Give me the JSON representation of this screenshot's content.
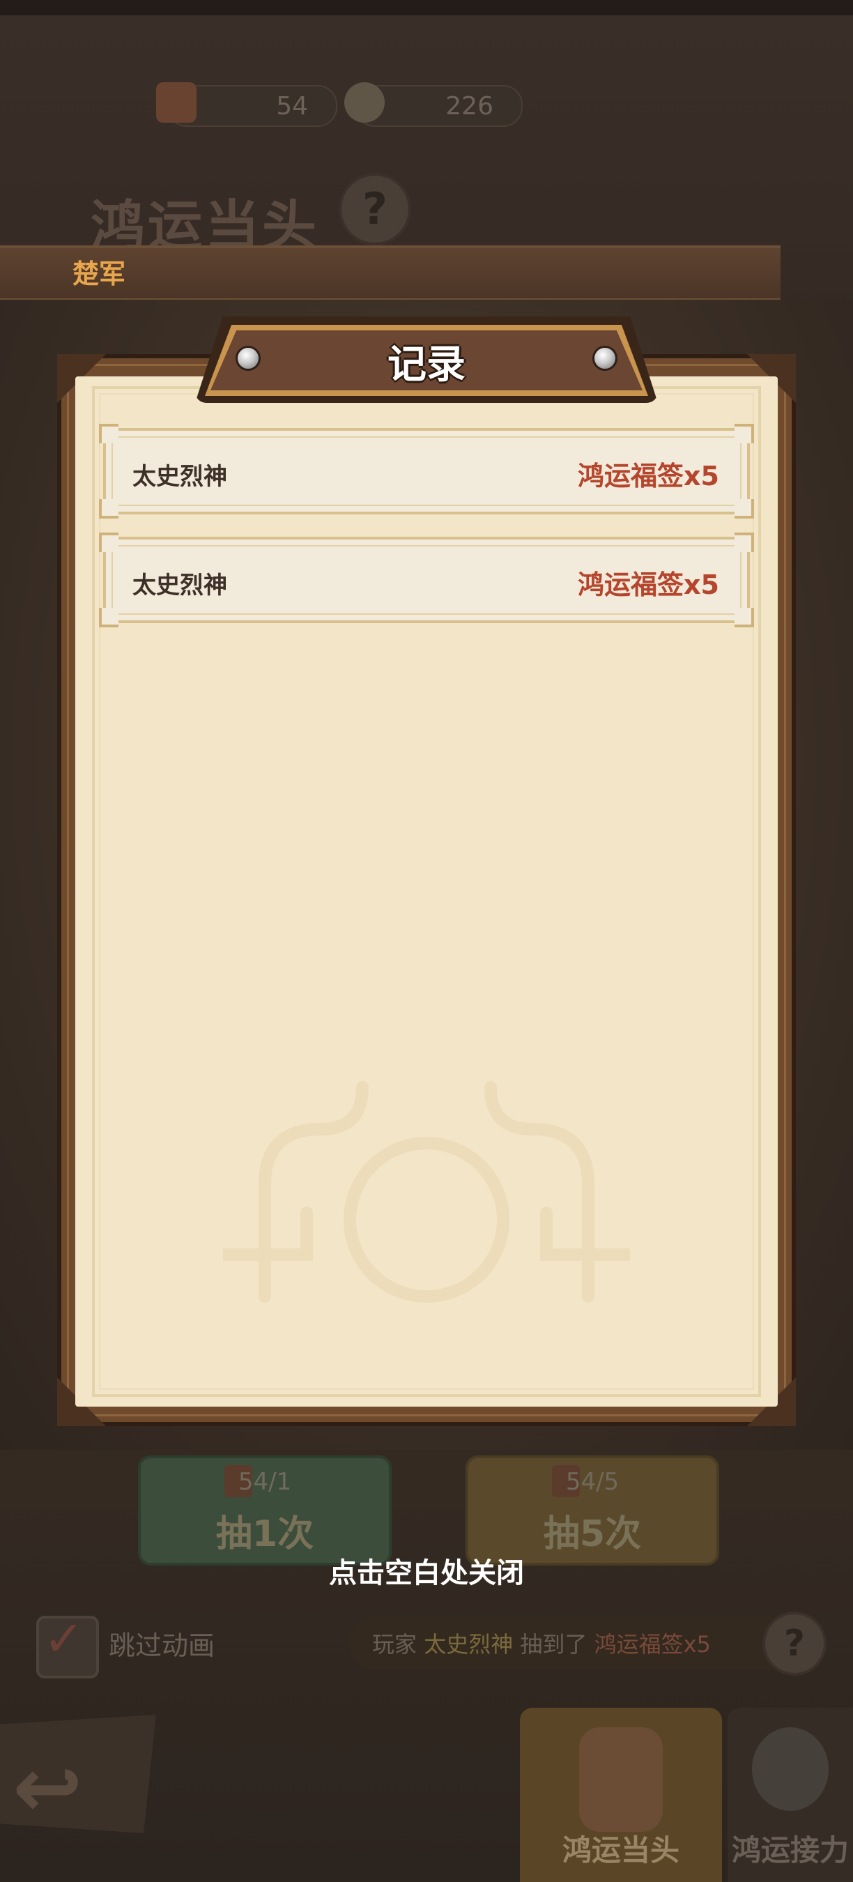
{
  "resources": [
    {
      "icon": "fortune-ticket-icon",
      "value": "54"
    },
    {
      "icon": "gold-ingot-icon",
      "value": "226"
    }
  ],
  "background": {
    "event_title": "鸿运当头",
    "ticker_text": "楚军",
    "draw_buttons": [
      {
        "count": "54/1",
        "label": "抽1次",
        "color": "#3c4d3b"
      },
      {
        "count": "54/5",
        "label": "抽5次",
        "color": "#5a4a2b"
      }
    ],
    "skip_animation_label": "跳过动画",
    "skip_animation_checked": true,
    "log": {
      "prefix": "玩家",
      "player": "太史烈神",
      "middle": "抽到了",
      "reward": "鸿运福签x5"
    },
    "nav": [
      {
        "label": "鸿运当头",
        "active": true
      },
      {
        "label": "鸿运接力",
        "active": false
      }
    ]
  },
  "modal": {
    "title": "记录",
    "records": [
      {
        "name": "太史烈神",
        "reward": "鸿运福签x5"
      },
      {
        "name": "太史烈神",
        "reward": "鸿运福签x5"
      }
    ],
    "close_hint": "点击空白处关闭"
  },
  "colors": {
    "reward_text": "#b5452c",
    "paper": "#f3e5c7",
    "frame": "#6f4a2c"
  }
}
